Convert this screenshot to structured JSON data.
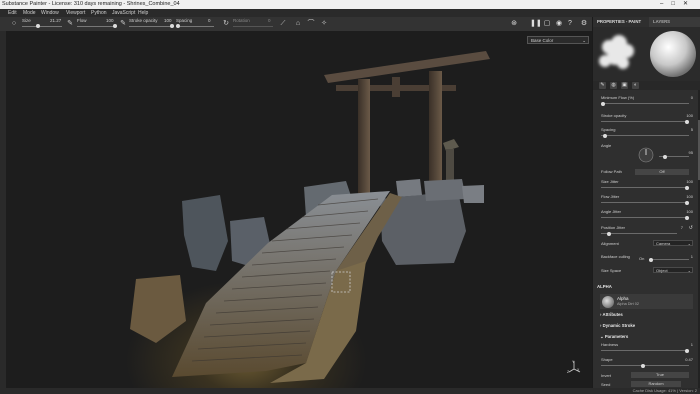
{
  "window": {
    "title": "Substance Painter - License: 310 days remaining - Shrines_Combine_04",
    "controls": [
      "–",
      "□",
      "✕"
    ]
  },
  "menu": [
    "Edit",
    "Mode",
    "Window",
    "Viewport",
    "Python",
    "JavaScript",
    "Help"
  ],
  "toolbar": {
    "size_label": "Size",
    "size_value": "21.27",
    "flow_label": "Flow",
    "flow_value": "100",
    "stroke_opacity_label": "Stroke opacity",
    "stroke_opacity_value": "100",
    "spacing_label": "Spacing",
    "spacing_value": "0",
    "rotation_label": "Rotation",
    "rotation_value": "0"
  },
  "viewport": {
    "channel_select": "Base Color",
    "axis": {
      "y": "Y",
      "z": "Z",
      "x": "X"
    }
  },
  "status": {
    "cache": "Cache Disk Usage: 41% | Version: 2"
  },
  "panel": {
    "tabs": {
      "properties": "PROPERTIES - PAINT",
      "layers": "LAYERS"
    },
    "rows": {
      "min_flow": {
        "label": "Minimum Flow (%)",
        "value": "0"
      },
      "stroke_opacity": {
        "label": "Stroke opacity",
        "value": "100"
      },
      "spacing": {
        "label": "Spacing",
        "value": "5"
      },
      "angle": {
        "label": "Angle",
        "value": "95"
      },
      "follow_path": {
        "label": "Follow Path",
        "value": "Off"
      },
      "size_jitter": {
        "label": "Size Jitter",
        "value": "100"
      },
      "flow_jitter": {
        "label": "Flow Jitter",
        "value": "100"
      },
      "angle_jitter": {
        "label": "Angle Jitter",
        "value": "100"
      },
      "position_jitter": {
        "label": "Position Jitter",
        "value": "7"
      },
      "alignment": {
        "label": "Alignment",
        "value": "Camera"
      },
      "backface_culling": {
        "label": "Backface culling",
        "value": "On",
        "number": "1"
      },
      "size_space": {
        "label": "Size Space",
        "value": "Object"
      }
    },
    "alpha": {
      "header": "ALPHA",
      "name": "Alpha",
      "sub": "Alpha Dirt 02"
    },
    "sections": {
      "attributes": "Attributes",
      "dynamic_stroke": "Dynamic Stroke",
      "parameters": "Parameters"
    },
    "params": {
      "hardness": {
        "label": "Hardness",
        "value": "1"
      },
      "shape": {
        "label": "Shape",
        "value": "0.47"
      },
      "invert": {
        "label": "Invert",
        "value": "True"
      },
      "seed": {
        "label": "Seed",
        "value": "Random"
      }
    }
  }
}
